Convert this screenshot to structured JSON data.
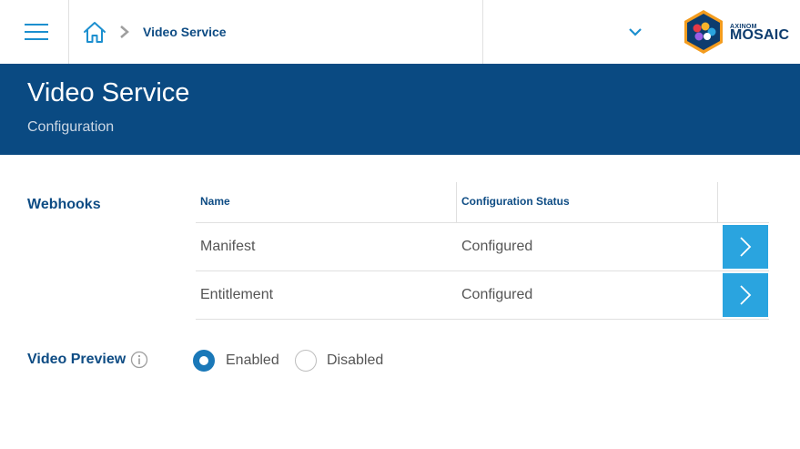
{
  "breadcrumb": {
    "current": "Video Service"
  },
  "logo": {
    "small": "AXINOM",
    "main": "MOSAIC"
  },
  "header": {
    "title": "Video Service",
    "subtitle": "Configuration"
  },
  "webhooks": {
    "label": "Webhooks",
    "columns": [
      "Name",
      "Configuration Status"
    ],
    "rows": [
      {
        "name": "Manifest",
        "status": "Configured"
      },
      {
        "name": "Entitlement",
        "status": "Configured"
      }
    ]
  },
  "video_preview": {
    "label": "Video Preview",
    "options": [
      "Enabled",
      "Disabled"
    ],
    "selected": "Enabled"
  },
  "colors": {
    "header_bg": "#0a4a82",
    "accent": "#2aa4df",
    "label": "#0e4c84"
  }
}
